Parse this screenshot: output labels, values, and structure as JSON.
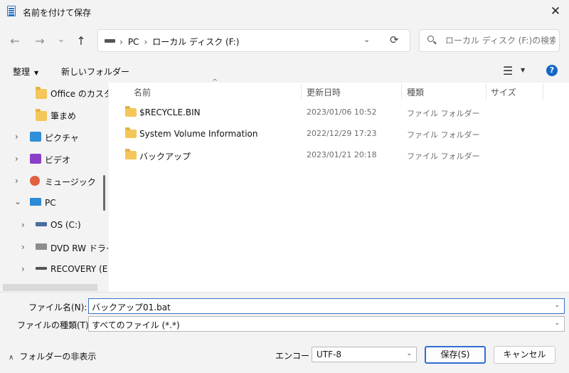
{
  "window": {
    "title": "名前を付けて保存",
    "close_glyph": "✕"
  },
  "nav": {
    "back_glyph": "←",
    "forward_glyph": "→",
    "recent_glyph": "⌄",
    "up_glyph": "↑",
    "breadcrumb": [
      "PC",
      "ローカル ディスク (F:)"
    ],
    "separator": "›",
    "dropdown_glyph": "⌄",
    "refresh_glyph": "⟳",
    "search_placeholder": "ローカル ディスク (F:)の検索"
  },
  "toolbar": {
    "organize_label": "整理",
    "organize_caret": "▼",
    "new_folder_label": "新しいフォルダー",
    "view_glyph": "☰",
    "view_caret": "▼",
    "help_glyph": "?"
  },
  "sidebar": {
    "items": [
      {
        "label": "Office のカスタ",
        "icon": "folder-icon"
      },
      {
        "label": "筆まめ",
        "icon": "folder-icon"
      },
      {
        "label": "ピクチャ",
        "icon": "pictures-icon",
        "chevron": "›"
      },
      {
        "label": "ビデオ",
        "icon": "videos-icon",
        "chevron": "›"
      },
      {
        "label": "ミュージック",
        "icon": "music-icon",
        "chevron": "›"
      },
      {
        "label": "PC",
        "icon": "pc-icon",
        "chevron": "⌄"
      },
      {
        "label": "OS (C:)",
        "icon": "os-drive-icon",
        "chevron": "›"
      },
      {
        "label": "DVD RW ドライ",
        "icon": "dvd-drive-icon",
        "chevron": "›"
      },
      {
        "label": "RECOVERY (E",
        "icon": "drive-icon",
        "chevron": "›"
      }
    ]
  },
  "columns": {
    "name": "名前",
    "modified": "更新日時",
    "type": "種類",
    "size": "サイズ"
  },
  "files": [
    {
      "name": "$RECYCLE.BIN",
      "modified": "2023/01/06 10:52",
      "type": "ファイル フォルダー"
    },
    {
      "name": "System Volume Information",
      "modified": "2022/12/29 17:23",
      "type": "ファイル フォルダー"
    },
    {
      "name": "バックアップ",
      "modified": "2023/01/21 20:18",
      "type": "ファイル フォルダー"
    }
  ],
  "form": {
    "filename_label": "ファイル名(N):",
    "filename_value": "バックアップ01.bat",
    "filetype_label": "ファイルの種類(T):",
    "filetype_value": "すべてのファイル  (*.*)",
    "dropdown_glyph": "⌄"
  },
  "footer": {
    "hide_folders_caret": "∧",
    "hide_folders_label": "フォルダーの非表示",
    "encoding_label": "エンコード:",
    "encoding_value": "UTF-8",
    "save_label": "保存(S)",
    "cancel_label": "キャンセル"
  }
}
